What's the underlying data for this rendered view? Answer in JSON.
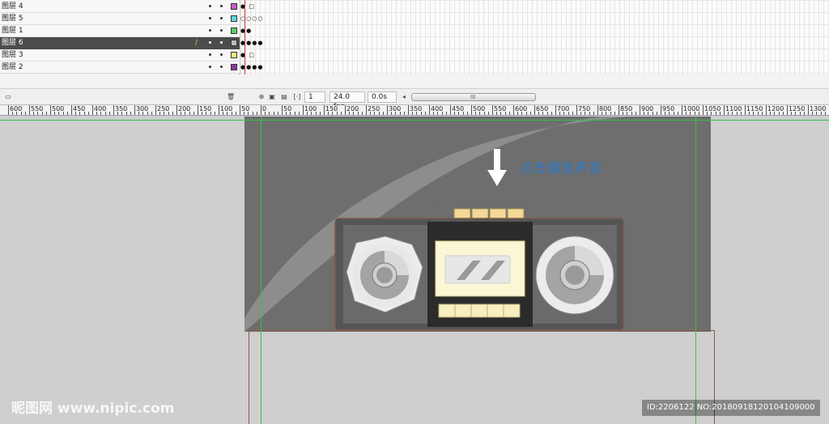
{
  "layers": [
    {
      "name": "图层 4",
      "color": "#c85bc8",
      "active": false,
      "frames": "●  □"
    },
    {
      "name": "图层 5",
      "color": "#62d6d6",
      "active": false,
      "frames": "○○○○"
    },
    {
      "name": "图层 1",
      "color": "#5bd061",
      "active": false,
      "frames": "●●"
    },
    {
      "name": "图层 6",
      "color": "#bdbdbd",
      "active": true,
      "frames": "●●●●"
    },
    {
      "name": "图层 3",
      "color": "#f2f27a",
      "active": false,
      "frames": "●  □"
    },
    {
      "name": "图层 2",
      "color": "#8a3aa5",
      "active": false,
      "frames": "●●●●"
    }
  ],
  "controls": {
    "current_frame": "1",
    "fps": "24.0 fps",
    "time": "0.0s",
    "scroll_grip": "III",
    "scroll_left_arrow": "◂",
    "icons": [
      "center-frame-icon",
      "onion-skin-icon",
      "onion-outline-icon",
      "edit-multiple-frames-icon",
      "modify-onion-markers-icon"
    ],
    "delete_icon": "trash-icon",
    "new_layer_icon": "new-folder-icon"
  },
  "ruler": {
    "labels": [
      "600",
      "550",
      "500",
      "450",
      "400",
      "350",
      "300",
      "250",
      "200",
      "150",
      "100",
      "50",
      "0",
      "50",
      "100",
      "150",
      "200",
      "250",
      "300",
      "350",
      "400",
      "450",
      "500",
      "550",
      "600",
      "650",
      "700",
      "750",
      "800",
      "850",
      "900",
      "950",
      "1000",
      "1050",
      "1100",
      "1150",
      "1200",
      "1250",
      "1300"
    ]
  },
  "stage": {
    "hint_text": "点击播放声音",
    "colors": {
      "stage": "#6e6e6e",
      "stage_highlight": "#8c8c8c",
      "radio_body": "#555555",
      "radio_center": "#2b2b2b",
      "cassette": "#fbf7d6",
      "button": "#f3d896",
      "guide": "#34c24a"
    }
  },
  "watermark": {
    "left": "昵图网 www.nipic.com",
    "right": "ID:2206122 NO:20180918120104109000"
  }
}
